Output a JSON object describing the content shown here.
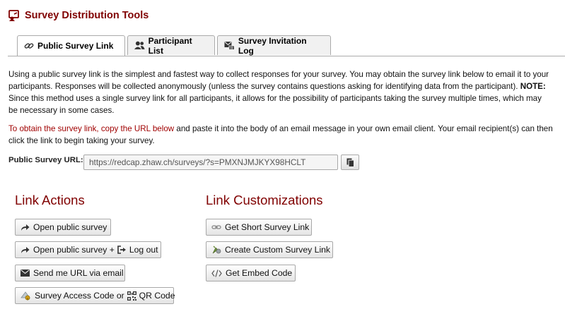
{
  "page": {
    "title": "Survey Distribution Tools"
  },
  "tabs": [
    {
      "label": "Public Survey Link",
      "icon": "link-icon",
      "active": true
    },
    {
      "label": "Participant List",
      "icon": "users-icon",
      "active": false
    },
    {
      "label": "Survey Invitation Log",
      "icon": "mail-log-icon",
      "active": false
    }
  ],
  "intro": {
    "text": "Using a public survey link is the simplest and fastest way to collect responses for your survey. You may obtain the survey link below to email it to your participants. Responses will be collected anonymously (unless the survey contains questions asking for identifying data from the participant). ",
    "note_label": "NOTE:",
    "note_text": " Since this method uses a single survey link for all participants, it allows for the possibility of participants taking the survey multiple times, which may be necessary in some cases."
  },
  "instructions": {
    "red_part": "To obtain the survey link, copy the URL below",
    "rest": " and paste it into the body of an email message in your own email client. Your email recipient(s) can then click the link to begin taking your survey."
  },
  "url_field": {
    "label": "Public Survey URL:",
    "value": "https://redcap.zhaw.ch/surveys/?s=PMXNJMJKYX98HCLT",
    "copy_icon": "clipboard-icon"
  },
  "link_actions": {
    "heading": "Link Actions",
    "open_survey": "Open public survey",
    "open_logout_a": "Open public survey +",
    "open_logout_b": "Log out",
    "send_email": "Send me URL via email",
    "access_code_a": "Survey Access Code or",
    "access_code_b": "QR Code"
  },
  "link_customizations": {
    "heading": "Link Customizations",
    "short_link": "Get Short Survey Link",
    "custom_link": "Create Custom Survey Link",
    "embed_code": "Get Embed Code"
  },
  "colors": {
    "accent": "#800000",
    "instruction_red": "#a00000"
  }
}
